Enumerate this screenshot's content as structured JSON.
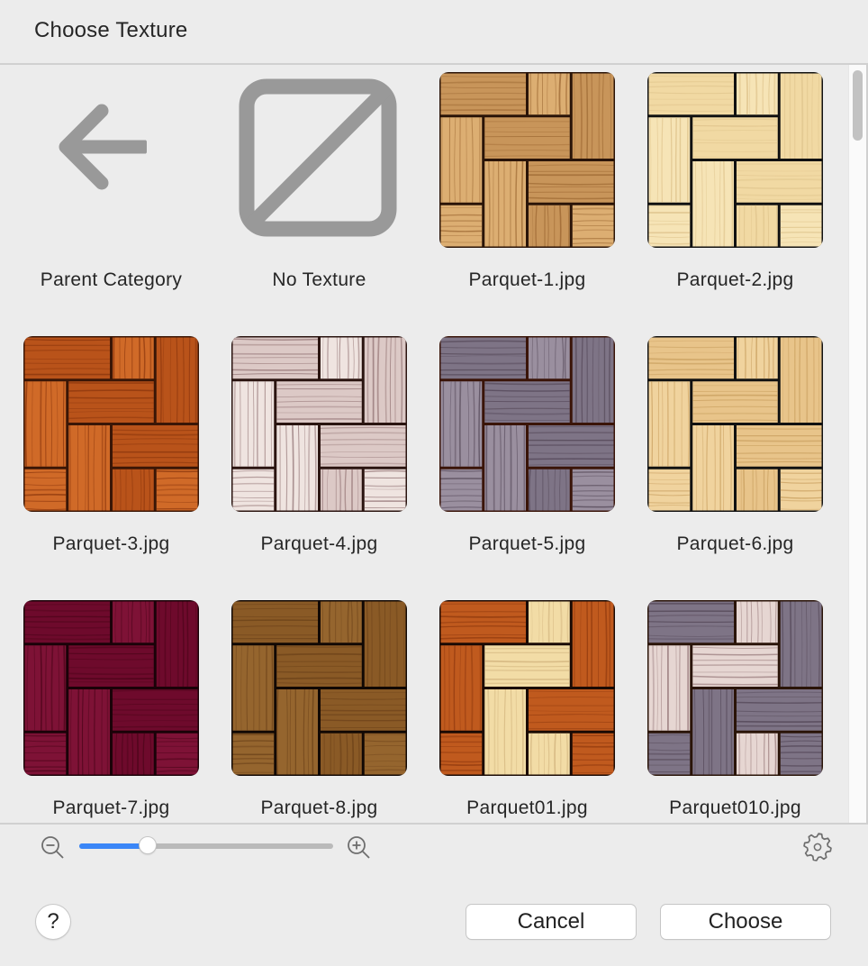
{
  "window": {
    "title": "Choose Texture"
  },
  "grid": {
    "items": [
      {
        "label": "Parent Category",
        "kind": "parent",
        "icon": "arrow-left-icon"
      },
      {
        "label": "No Texture",
        "kind": "none",
        "icon": "no-texture-icon"
      },
      {
        "label": "Parquet-1.jpg",
        "kind": "texture",
        "colors": {
          "a": "#c8955a",
          "b": "#dcae72",
          "grain": "#9a6530",
          "line": "#2a1408"
        }
      },
      {
        "label": "Parquet-2.jpg",
        "kind": "texture",
        "colors": {
          "a": "#f1d9a3",
          "b": "#f6e4b6",
          "grain": "#dcc088",
          "line": "#111111"
        }
      },
      {
        "label": "Parquet-3.jpg",
        "kind": "texture",
        "colors": {
          "a": "#b9531a",
          "b": "#d06a28",
          "grain": "#8a350c",
          "line": "#3a1606"
        }
      },
      {
        "label": "Parquet-4.jpg",
        "kind": "texture",
        "colors": {
          "a": "#dcc9c6",
          "b": "#efe4e0",
          "grain": "#8f6f70",
          "line": "#2a1410"
        }
      },
      {
        "label": "Parquet-5.jpg",
        "kind": "texture",
        "colors": {
          "a": "#7e7486",
          "b": "#9a8f9f",
          "grain": "#514454",
          "line": "#3a1408"
        }
      },
      {
        "label": "Parquet-6.jpg",
        "kind": "texture",
        "colors": {
          "a": "#e8c48a",
          "b": "#f0d39e",
          "grain": "#c79c5c",
          "line": "#111111"
        }
      },
      {
        "label": "Parquet-7.jpg",
        "kind": "texture",
        "colors": {
          "a": "#6e0a2c",
          "b": "#7e1236",
          "grain": "#4a0418",
          "line": "#1a0208"
        }
      },
      {
        "label": "Parquet-8.jpg",
        "kind": "texture",
        "colors": {
          "a": "#8a5a26",
          "b": "#95652e",
          "grain": "#6a4018",
          "line": "#110804"
        }
      },
      {
        "label": "Parquet01.jpg",
        "kind": "texture",
        "mixed": true,
        "colors": {
          "a": "#c05a1e",
          "b": "#f2dca6",
          "grain": "#8a350c",
          "line": "#1a0a04"
        }
      },
      {
        "label": "Parquet010.jpg",
        "kind": "texture",
        "mixed": true,
        "colors": {
          "a": "#7e7486",
          "b": "#e6d6d2",
          "grain": "#514454",
          "line": "#2a1408"
        }
      }
    ]
  },
  "toolbar": {
    "zoom_out_icon": "zoom-out-icon",
    "zoom_in_icon": "zoom-in-icon",
    "zoom_level": 0.27,
    "settings_icon": "gear-icon",
    "accent": "#3a86f7"
  },
  "footer": {
    "help_label": "?",
    "cancel_label": "Cancel",
    "choose_label": "Choose"
  }
}
